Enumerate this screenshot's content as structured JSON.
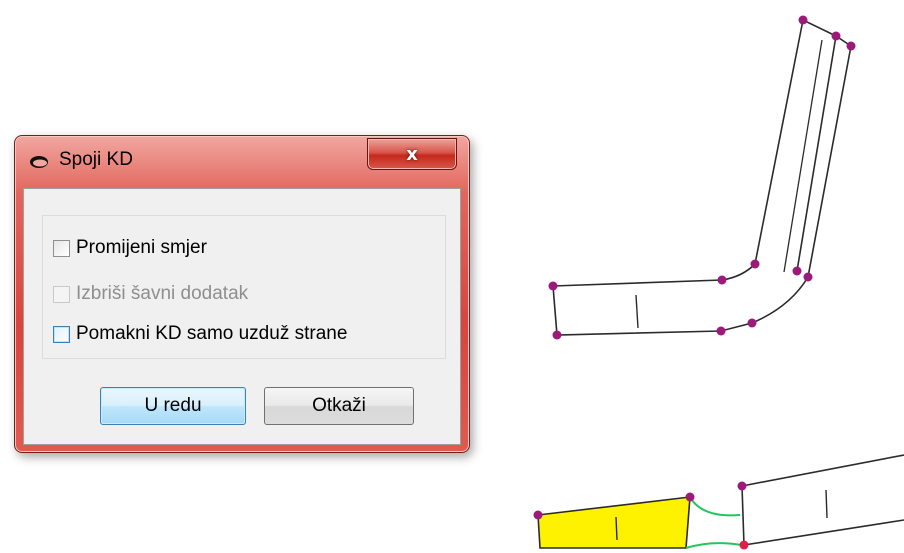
{
  "dialog": {
    "title": "Spoji KD",
    "close_label": "x",
    "options": [
      {
        "label": "Promijeni smjer",
        "checked": false,
        "enabled": true
      },
      {
        "label": "Izbriši šavni dodatak",
        "checked": false,
        "enabled": false
      },
      {
        "label": "Pomakni KD samo uzduž strane",
        "checked": false,
        "enabled": true
      }
    ],
    "ok_label": "U redu",
    "cancel_label": "Otkaži"
  },
  "colors": {
    "titlebar": "#d8453c",
    "vertex": "#9c1a7a",
    "piece_fill": "#fff200",
    "connector": "#22c55e",
    "line": "#222222"
  }
}
